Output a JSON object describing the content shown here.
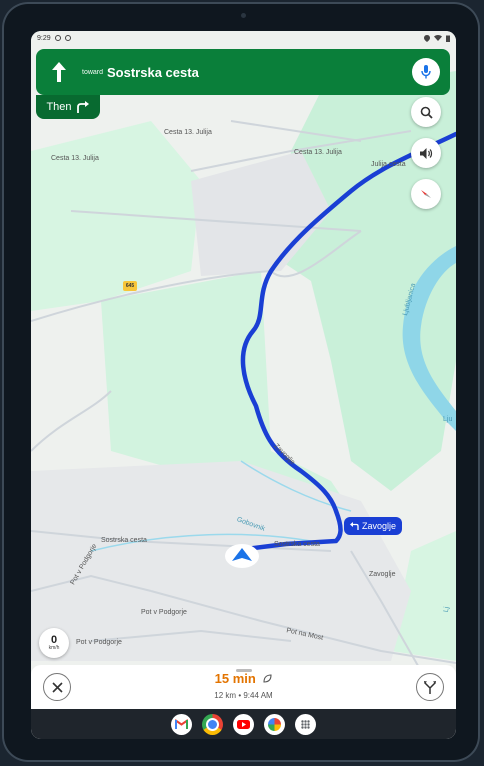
{
  "status_bar": {
    "time": "9:29"
  },
  "navigation": {
    "toward_label": "toward",
    "street": "Sostrska cesta",
    "then_label": "Then",
    "next_turn_street": "Zavoglje"
  },
  "map_labels": {
    "route_number": "645",
    "street_13_julija_a": "Cesta 13. Julija",
    "street_13_julija_b": "Cesta 13. Julija",
    "street_13_julija_c": "Cesta 13. Julija",
    "street_julija": "Julija cesta",
    "street_zagorje": "Zavoglje",
    "street_zavoglje_route": "Zavoglje",
    "street_podgorje_a": "Pot v Podgorje",
    "street_podgorje_b": "Pot v Podgorje",
    "street_podgorje_c": "Pot v Podgorje",
    "street_sostrska": "Sostrska cesta",
    "street_sostrska_route": "Sostrska cesta",
    "street_na_most": "Pot na Most",
    "stream": "Gobovnik",
    "river_a": "Ljubljanica",
    "river_b": "Lju",
    "river_c": "Lj",
    "street_zavoglje_low": "Zavoglje"
  },
  "speed": {
    "value": "0",
    "unit": "km/h"
  },
  "trip": {
    "duration": "15 min",
    "distance": "12 km",
    "separator": "•",
    "arrival": "9:44 AM"
  },
  "icons": {
    "straight": "arrow-up-icon",
    "turn_right": "turn-right-icon",
    "mic": "mic-icon",
    "search": "search-icon",
    "volume": "volume-icon",
    "compass": "compass-icon",
    "close": "close-icon",
    "alt_routes": "alt-routes-icon"
  },
  "dock_apps": [
    "Gmail",
    "Chrome",
    "YouTube",
    "Photos",
    "App drawer"
  ],
  "colors": {
    "banner": "#0a7f3a",
    "route": "#1a3fd4",
    "eta": "#e37400"
  }
}
